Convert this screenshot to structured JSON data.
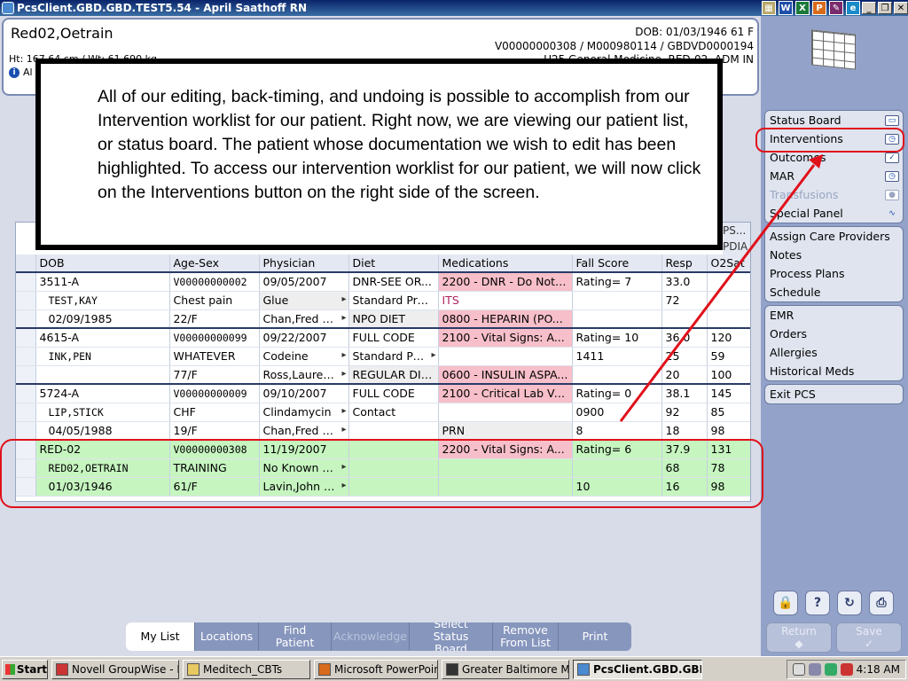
{
  "window": {
    "title": "PcsClient.GBD.GBD.TEST5.54 - April Saathoff RN"
  },
  "header": {
    "patient_name": "Red02,Oetrain",
    "dob_line": "DOB: 01/03/1946 61 F",
    "acct_line": "V00000000308 / M000980114 / GBDVD0000194",
    "ht_wt": "Ht: 167.64 cm / Wt: 61.690 kg",
    "location": "U25 General Medicine, RED-02, ADM IN",
    "alert_prefix": "Al"
  },
  "callout": {
    "text": "All of our editing, back-timing, and undoing is possible to accomplish from our Intervention worklist for our patient. Right now, we are viewing our patient list, or status board. The patient whose documentation we wish to edit has been highlighted. To access our intervention worklist for our patient, we will now click on the Interventions button on the right side of the screen."
  },
  "grid": {
    "extra_header_1": "PS...",
    "extra_header_2": "PDIA",
    "columns": [
      "DOB",
      "Age-Sex",
      "Physician",
      "Diet",
      "Medications",
      "Fall Score",
      "Resp",
      "O2Sat"
    ],
    "rows": [
      [
        "3511-A",
        "V00000000002",
        "09/05/2007",
        "DNR-SEE OR...",
        "2200 - DNR - Do Not ...",
        "Rating= 7",
        "33.0",
        ""
      ],
      [
        "TEST,KAY",
        "Chest pain",
        "Glue",
        "Standard Pre...",
        "ITS",
        "",
        "72",
        ""
      ],
      [
        "02/09/1985",
        "22/F",
        "Chan,Fred T ...",
        "NPO DIET",
        "0800 - HEPARIN (PO...",
        "",
        "",
        ""
      ],
      [
        "4615-A",
        "V00000000099",
        "09/22/2007",
        "FULL CODE",
        "2100 - Vital Signs: A...",
        "Rating= 10",
        "36.0",
        "120"
      ],
      [
        "INK,PEN",
        "WHATEVER",
        "Codeine",
        "Standard Pre...",
        "",
        "1411",
        "25",
        "59"
      ],
      [
        "",
        "77/F",
        "Ross,Laurenc...",
        "REGULAR DIET",
        "0600 - INSULIN ASPA...",
        "",
        "20",
        "100"
      ],
      [
        "5724-A",
        "V00000000009",
        "09/10/2007",
        "FULL CODE",
        "2100 - Critical Lab Va...",
        "Rating= 0",
        "38.1",
        "145"
      ],
      [
        "LIP,STICK",
        "CHF",
        "Clindamycin",
        "Contact",
        "",
        "0900",
        "92",
        "85"
      ],
      [
        "04/05/1988",
        "19/F",
        "Chan,Fred T ...",
        "",
        "PRN",
        "8",
        "18",
        "98"
      ],
      [
        "RED-02",
        "V00000000308",
        "11/19/2007",
        "",
        "2200 - Vital Signs: A...",
        "Rating= 6",
        "37.9",
        "131"
      ],
      [
        "RED02,OETRAIN",
        "TRAINING",
        "No Known All...",
        "",
        "",
        "",
        "68",
        "78"
      ],
      [
        "01/03/1946",
        "61/F",
        "Lavin,John G ...",
        "",
        "",
        "10",
        "16",
        "98"
      ]
    ]
  },
  "nav": {
    "group1": [
      "Status Board",
      "Interventions",
      "Outcomes",
      "MAR",
      "Transfusions",
      "Special Panel"
    ],
    "group2": [
      "Assign Care Providers",
      "Notes",
      "Process Plans",
      "Schedule"
    ],
    "group3": [
      "EMR",
      "Orders",
      "Allergies",
      "Historical Meds"
    ],
    "group4": [
      "Exit PCS"
    ]
  },
  "tool_buttons": [
    "🔒",
    "?",
    "↻",
    "⎙"
  ],
  "actions": {
    "return": "Return",
    "save": "Save"
  },
  "tabs": [
    "My List",
    "Locations",
    "Find Patient",
    "Acknowledge",
    "Select Status Board",
    "Remove From List",
    "Print"
  ],
  "taskbar": {
    "start": "Start",
    "tasks": [
      "Novell GroupWise - M...",
      "Meditech_CBTs",
      "Microsoft PowerPoint ...",
      "Greater Baltimore Me...",
      "PcsClient.GBD.GBD...."
    ],
    "time": "4:18 AM"
  },
  "colors": {
    "highlight": "#e0101a",
    "selected_row": "#c6f5c0",
    "med_alert": "#f7bfc9"
  }
}
